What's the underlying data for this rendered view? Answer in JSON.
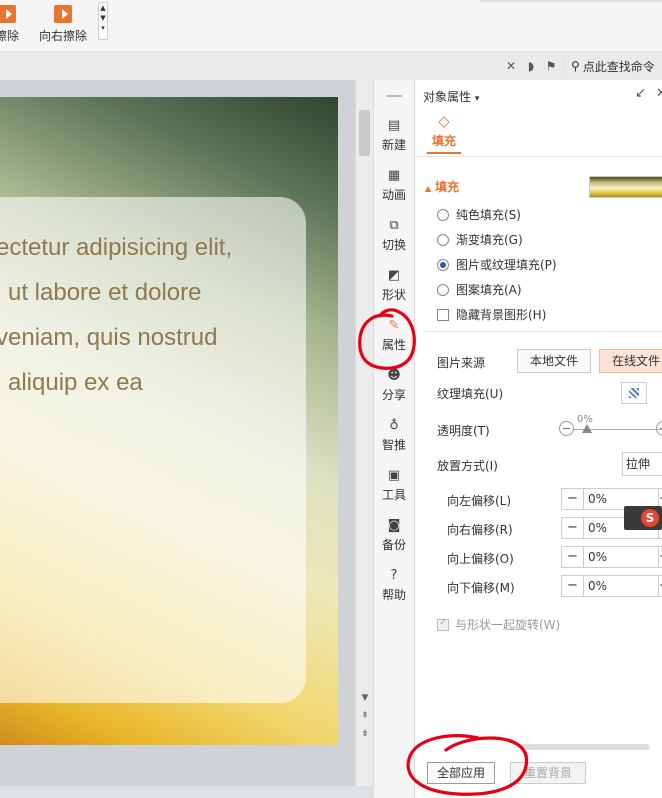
{
  "ribbon": {
    "btn_left_label": "擦除",
    "btn_right_label": "向右擦除"
  },
  "toolbar": {
    "search_label": "点此查找命令"
  },
  "slide": {
    "lines": [
      "ectetur adipisicing elit,",
      "ut labore et dolore",
      "veniam, quis nostrud",
      "aliquip ex ea"
    ]
  },
  "toolcol": {
    "items": [
      {
        "label": "新建",
        "icon": "new-doc-icon"
      },
      {
        "label": "动画",
        "icon": "animation-icon"
      },
      {
        "label": "切换",
        "icon": "transition-icon"
      },
      {
        "label": "形状",
        "icon": "shape-icon"
      },
      {
        "label": "属性",
        "icon": "property-icon"
      },
      {
        "label": "分享",
        "icon": "share-icon"
      },
      {
        "label": "智推",
        "icon": "smart-icon"
      },
      {
        "label": "工具",
        "icon": "tools-icon"
      },
      {
        "label": "备份",
        "icon": "backup-icon"
      },
      {
        "label": "帮助",
        "icon": "help-icon"
      }
    ],
    "active": "属性"
  },
  "panel": {
    "title": "对象属性",
    "tab_fill": "填充",
    "section_fill": "填充",
    "fill_options": [
      {
        "label": "纯色填充(S)",
        "checked": false
      },
      {
        "label": "渐变填充(G)",
        "checked": false
      },
      {
        "label": "图片或纹理填充(P)",
        "checked": true
      },
      {
        "label": "图案填充(A)",
        "checked": false
      }
    ],
    "hide_bg_shapes": "隐藏背景图形(H)",
    "image_source_label": "图片来源",
    "local_file": "本地文件",
    "online_file": "在线文件",
    "texture_fill_label": "纹理填充(U)",
    "transparency_label": "透明度(T)",
    "transparency_value": "0%",
    "placement_label": "放置方式(I)",
    "placement_value": "拉伸",
    "offsets": [
      {
        "label": "向左偏移(L)",
        "value": "0%"
      },
      {
        "label": "向右偏移(R)",
        "value": "0%"
      },
      {
        "label": "向上偏移(O)",
        "value": "0%"
      },
      {
        "label": "向下偏移(M)",
        "value": "0%"
      }
    ],
    "rotate_with_shape": "与形状一起旋转(W)",
    "apply_all": "全部应用",
    "reset_bg": "重置背景"
  },
  "colors": {
    "accent": "#e9742f",
    "annotation": "#e60012"
  }
}
